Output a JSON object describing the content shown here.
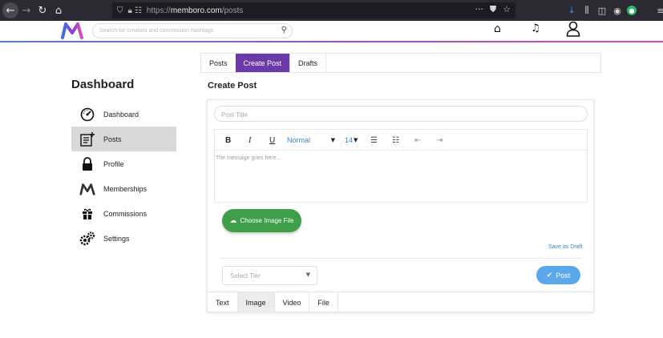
{
  "browser": {
    "url_prefix": "https://",
    "url_domain": "memboro.com",
    "url_path": "/posts",
    "icons": [
      "back-icon",
      "forward-icon",
      "reload-icon",
      "home-icon",
      "shield-icon",
      "lock-icon",
      "permissions-icon",
      "more-icon",
      "pocket-icon",
      "bookmark-star-icon",
      "download-icon",
      "library-icon",
      "sidebar-icon",
      "account-icon",
      "extension-icon",
      "menu-icon"
    ]
  },
  "header": {
    "search_placeholder": "Search for creators and commission hashtags"
  },
  "sidebar": {
    "title": "Dashboard",
    "items": [
      {
        "label": "Dashboard",
        "icon": "speedometer-icon"
      },
      {
        "label": "Posts",
        "icon": "post-add-icon"
      },
      {
        "label": "Profile",
        "icon": "lock-icon"
      },
      {
        "label": "Memberships",
        "icon": "m-logo-icon"
      },
      {
        "label": "Commissions",
        "icon": "gift-icon"
      },
      {
        "label": "Settings",
        "icon": "gears-icon"
      }
    ],
    "active": "Posts"
  },
  "tabs": [
    {
      "label": "Posts"
    },
    {
      "label": "Create Post"
    },
    {
      "label": "Drafts"
    }
  ],
  "main": {
    "title": "Create Post",
    "post_title_placeholder": "Post Title",
    "editor": {
      "bold": "B",
      "italic": "I",
      "underline": "U",
      "font_style": "Normal",
      "font_size": "14",
      "body_placeholder": "The message goes here..."
    },
    "upload_label": "Choose Image File",
    "save_draft": "Save as Draft",
    "tier_placeholder": "Select Tier",
    "post_label": "Post",
    "bottom_tabs": [
      {
        "label": "Text"
      },
      {
        "label": "Image"
      },
      {
        "label": "Video"
      },
      {
        "label": "File"
      }
    ],
    "active_bottom_tab": "Image"
  },
  "colors": {
    "brand_purple": "#6a3aa8",
    "green": "#3da048",
    "blue": "#5aa7ec",
    "link_blue": "#3b84c8"
  }
}
